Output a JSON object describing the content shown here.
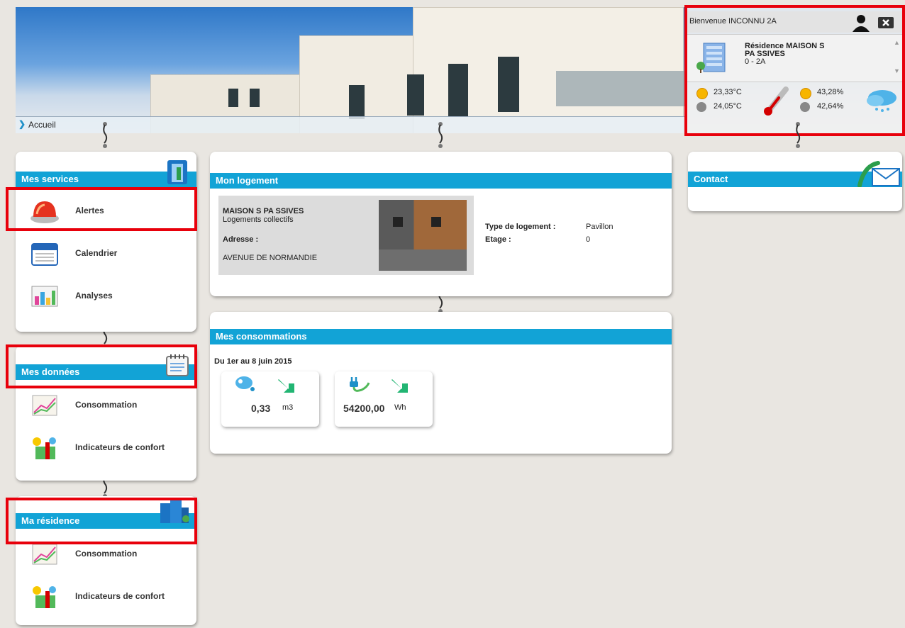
{
  "breadcrumb": {
    "label": "Accueil"
  },
  "user_panel": {
    "welcome": "Bienvenue INCONNU 2A",
    "residence_line1": "Résidence MAISON S",
    "residence_line2": "PA SSIVES",
    "residence_line3": "0 - 2A",
    "temp_out": "23,33°C",
    "temp_in": "24,05°C",
    "hum_out": "43,28%",
    "hum_in": "42,64%"
  },
  "mes_services": {
    "title": "Mes services",
    "items": [
      {
        "label": "Alertes"
      },
      {
        "label": "Calendrier"
      },
      {
        "label": "Analyses"
      }
    ]
  },
  "mes_donnees": {
    "title": "Mes données",
    "items": [
      {
        "label": "Consommation"
      },
      {
        "label": "Indicateurs de confort"
      }
    ]
  },
  "ma_residence": {
    "title": "Ma résidence",
    "items": [
      {
        "label": "Consommation"
      },
      {
        "label": "Indicateurs de confort"
      }
    ]
  },
  "mon_logement": {
    "title": "Mon logement",
    "name": "MAISON S PA SSIVES",
    "subtitle": "Logements collectifs",
    "address_label": "Adresse :",
    "address": "AVENUE DE NORMANDIE",
    "type_label": "Type de logement :",
    "type_value": "Pavillon",
    "etage_label": "Etage :",
    "etage_value": "0"
  },
  "mes_consommations": {
    "title": "Mes consommations",
    "period": "Du 1er au 8 juin 2015",
    "water_value": "0,33",
    "water_unit": "m3",
    "elec_value": "54200,00",
    "elec_unit": "Wh"
  },
  "contact": {
    "title": "Contact"
  },
  "colors": {
    "header_blue": "#12a3d6",
    "highlight_red": "#e8000b",
    "trend_green": "#22b573"
  }
}
